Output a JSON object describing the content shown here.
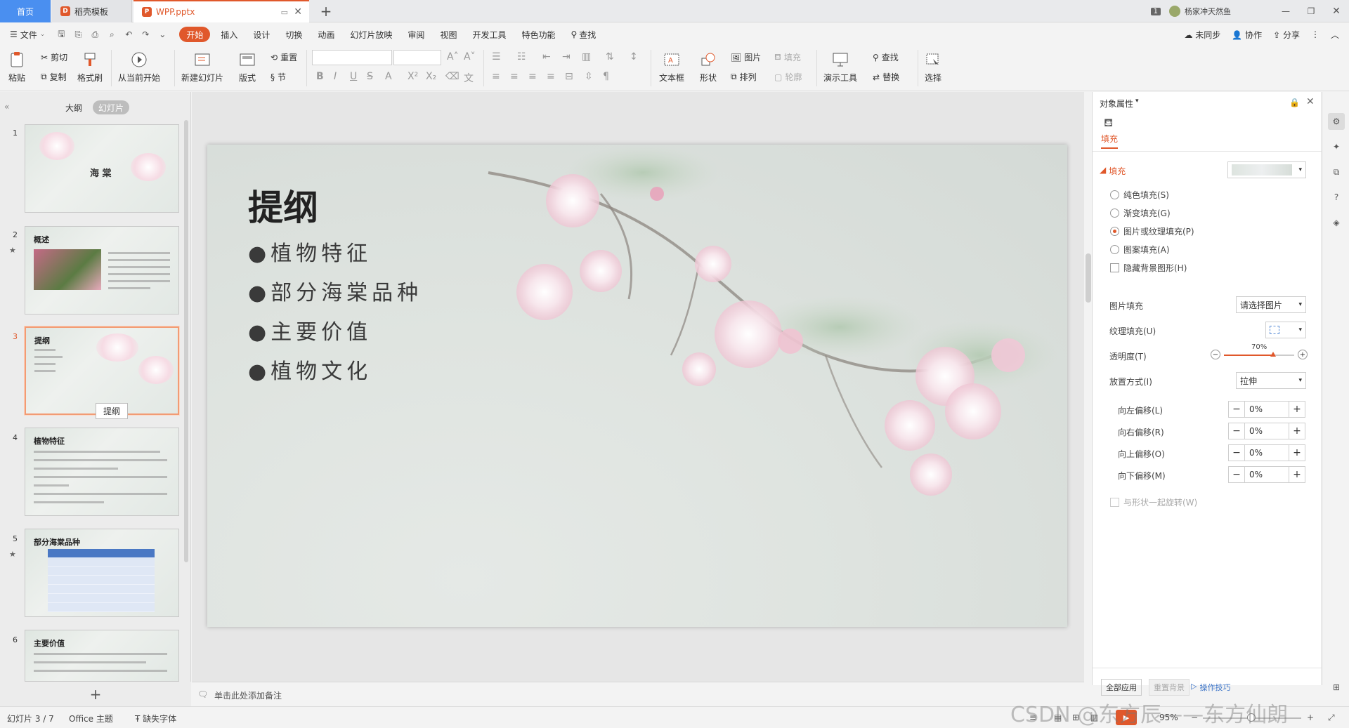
{
  "titlebar": {
    "tabs": [
      {
        "label": "首页"
      },
      {
        "label": "稻壳模板"
      },
      {
        "label": "WPP.pptx"
      }
    ],
    "page_badge": "1",
    "user_name": "杨家冲天然鱼"
  },
  "menubar": {
    "file_label": "文件",
    "menus": [
      "开始",
      "插入",
      "设计",
      "切换",
      "动画",
      "幻灯片放映",
      "审阅",
      "视图",
      "开发工具",
      "特色功能"
    ],
    "search_label": "查找",
    "sync_label": "未同步",
    "collab_label": "协作",
    "share_label": "分享"
  },
  "ribbon": {
    "paste": "粘贴",
    "cut": "剪切",
    "copy": "复制",
    "format_painter": "格式刷",
    "from_current": "从当前开始",
    "new_slide": "新建幻灯片",
    "layout": "版式",
    "reset": "重置",
    "section": "节",
    "textbox": "文本框",
    "shape": "形状",
    "picture": "图片",
    "fill": "填充",
    "arrange": "排列",
    "outline": "轮廓",
    "presenter_tools": "演示工具",
    "find": "查找",
    "replace": "替换",
    "select": "选择"
  },
  "leftpanel": {
    "tab_outline": "大纲",
    "tab_slides": "幻灯片",
    "tooltip": "提纲",
    "slides": [
      {
        "num": "1",
        "title": "海 棠"
      },
      {
        "num": "2",
        "title": "概述"
      },
      {
        "num": "3",
        "title": "提纲"
      },
      {
        "num": "4",
        "title": "植物特征"
      },
      {
        "num": "5",
        "title": "部分海棠品种"
      },
      {
        "num": "6",
        "title": "主要价值"
      }
    ]
  },
  "slide": {
    "title": "提纲",
    "bullets": [
      "植物特征",
      "部分海棠品种",
      "主要价值",
      "植物文化"
    ]
  },
  "notes": {
    "placeholder": "单击此处添加备注"
  },
  "rightpanel": {
    "header": "对象属性",
    "tab_fill": "填充",
    "section_fill": "填充",
    "options": [
      "纯色填充(S)",
      "渐变填充(G)",
      "图片或纹理填充(P)",
      "图案填充(A)"
    ],
    "hide_bg": "隐藏背景图形(H)",
    "picture_fill_label": "图片填充",
    "picture_fill_value": "请选择图片",
    "texture_fill_label": "纹理填充(U)",
    "transparency_label": "透明度(T)",
    "transparency_value": "70%",
    "transparency_level": 0.7,
    "placement_label": "放置方式(I)",
    "placement_value": "拉伸",
    "offsets": [
      {
        "label": "向左偏移(L)",
        "value": "0%"
      },
      {
        "label": "向右偏移(R)",
        "value": "0%"
      },
      {
        "label": "向上偏移(O)",
        "value": "0%"
      },
      {
        "label": "向下偏移(M)",
        "value": "0%"
      }
    ],
    "rotate_with_shape": "与形状一起旋转(W)",
    "apply_all": "全部应用",
    "reset_bg": "重置背景",
    "tips": "操作技巧"
  },
  "statusbar": {
    "slide_info": "幻灯片 3 / 7",
    "theme": "Office 主题",
    "missing_fonts": "缺失字体",
    "zoom": "95%",
    "watermark": "CSDN @东方辰——东方仙朗"
  },
  "colors": {
    "accent": "#e0582b",
    "home_tab": "#4a8ff0"
  }
}
